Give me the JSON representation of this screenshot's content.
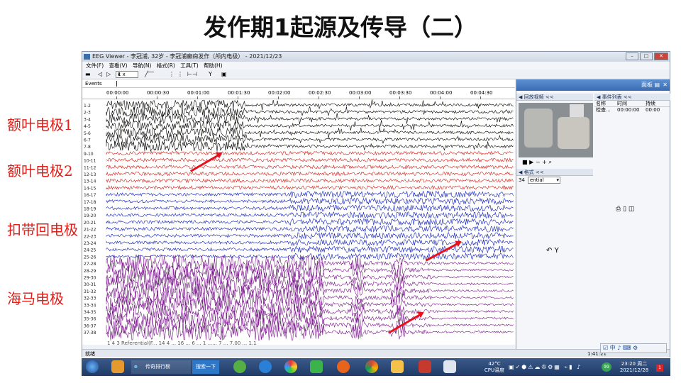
{
  "slide": {
    "title": "发作期1起源及传导（二）",
    "labels": [
      "额叶电极1",
      "额叶电极2",
      "扣带回电极",
      "海马电极"
    ]
  },
  "window": {
    "title": "EEG Viewer - 李冠浦, 32岁 - 李冠浦癫痫发作（颅内电极） - 2021/12/23",
    "menu": [
      "文件(F)",
      "查看(V)",
      "导航(N)",
      "格式(R)",
      "工具(T)",
      "帮助(H)"
    ],
    "toolbar": {
      "zoom": "1 x"
    },
    "events_label": "Events",
    "time_ticks": [
      "00:00:00",
      "00:00:30",
      "00:01:00",
      "00:01:30",
      "00:02:00",
      "00:02:30",
      "00:03:00",
      "00:03:30",
      "00:04:00",
      "00:04:30"
    ],
    "status_left": "就绪",
    "status_right": "1:41:21",
    "footnote": "1 4 3 Referential(F... 14 4 ... 16 ... 6 ... 1 ...... 7 ... 7.00 ... 1.1"
  },
  "channels": {
    "labels": [
      "1-2",
      "2-3",
      "3-4",
      "4-5",
      "5-6",
      "6-7",
      "7-8",
      "9-10",
      "10-11",
      "11-12",
      "12-13",
      "13-14",
      "14-15",
      "16-17",
      "17-18",
      "18-19",
      "19-20",
      "20-21",
      "21-22",
      "22-23",
      "23-24",
      "24-25",
      "25-26",
      "27-28",
      "28-29",
      "29-30",
      "30-31",
      "31-32",
      "32-33",
      "33-34",
      "34-35",
      "35-36",
      "36-37",
      "37-38"
    ],
    "colors": {
      "frontal1": "#000000",
      "frontal2": "#d0201a",
      "cingulate": "#1020b8",
      "hippocampus": "#7a1a8c"
    }
  },
  "panel": {
    "title": "面板",
    "video_title": "回放视频 <<",
    "events_title": "事件列表 <<",
    "events_headers": [
      "名称",
      "时间",
      "持续"
    ],
    "events_rows": [
      [
        "检查...",
        "00:00:00",
        "00:00"
      ]
    ],
    "format_title": "格式 <<",
    "format_value": "ential",
    "format_prefix": "34"
  },
  "taskbar": {
    "items": [
      "传奇排行榜",
      "搜索一下"
    ],
    "temp": "42°C",
    "cpu": "CPU温度",
    "time": "23:20 周二",
    "date": "2021/12/28",
    "ime": "中"
  }
}
